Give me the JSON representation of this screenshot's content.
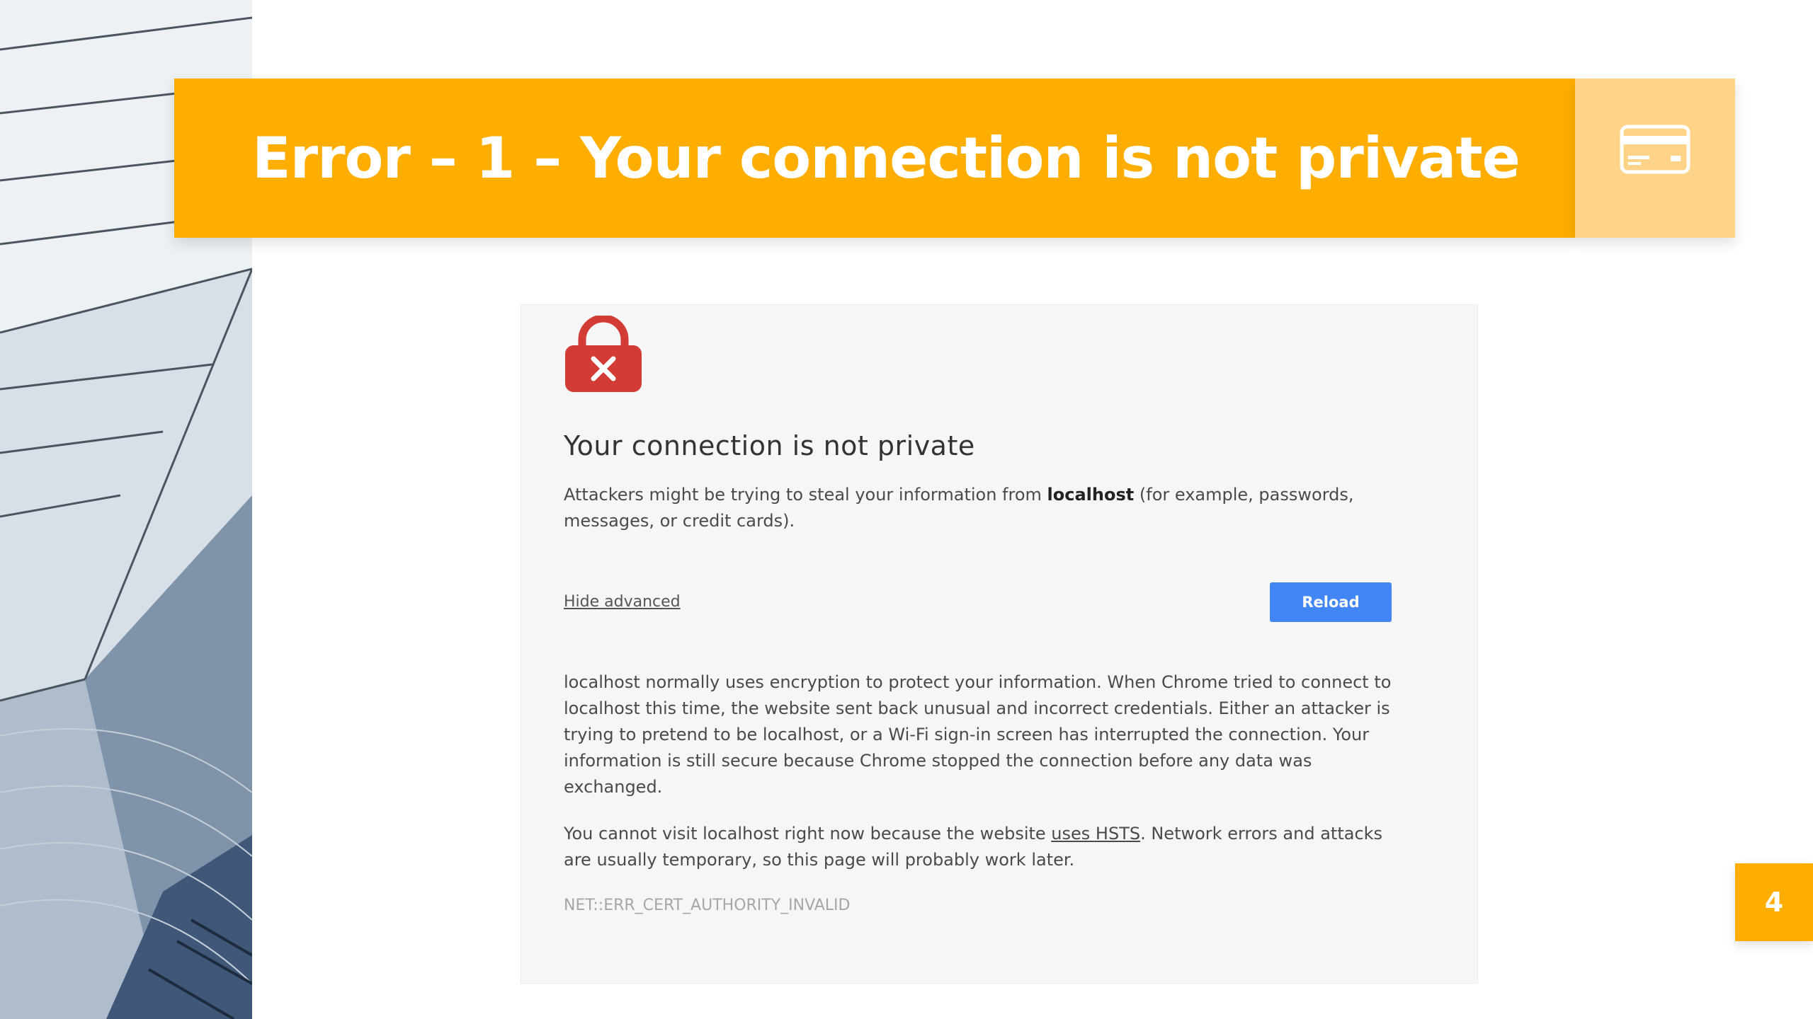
{
  "slide": {
    "title": "Error – 1 – Your connection is not private",
    "title_icon": "credit-card-icon",
    "page_number": "4",
    "accent_color": "#FFAE00",
    "accent_light_color": "#FFD488"
  },
  "browser_error": {
    "icon": "broken-lock-icon",
    "heading": "Your connection is not private",
    "intro": {
      "before": "Attackers might be trying to steal your information from ",
      "host": "localhost",
      "after": " (for example, passwords, messages, or credit cards)."
    },
    "hide_advanced_label": "Hide advanced",
    "reload_label": "Reload",
    "reload_color": "#4285F4",
    "details": "localhost normally uses encryption to protect your information. When Chrome tried to connect to localhost this time, the website sent back unusual and incorrect credentials. Either an attacker is trying to pretend to be localhost, or a Wi-Fi sign-in screen has interrupted the connection. Your information is still secure because Chrome stopped the connection before any data was exchanged.",
    "hsts": {
      "before": "You cannot visit localhost right now because the website ",
      "link": "uses HSTS",
      "after": ". Network errors and attacks are usually temporary, so this page will probably work later."
    },
    "error_code": "NET::ERR_CERT_AUTHORITY_INVALID",
    "lock_color": "#D33B35"
  }
}
